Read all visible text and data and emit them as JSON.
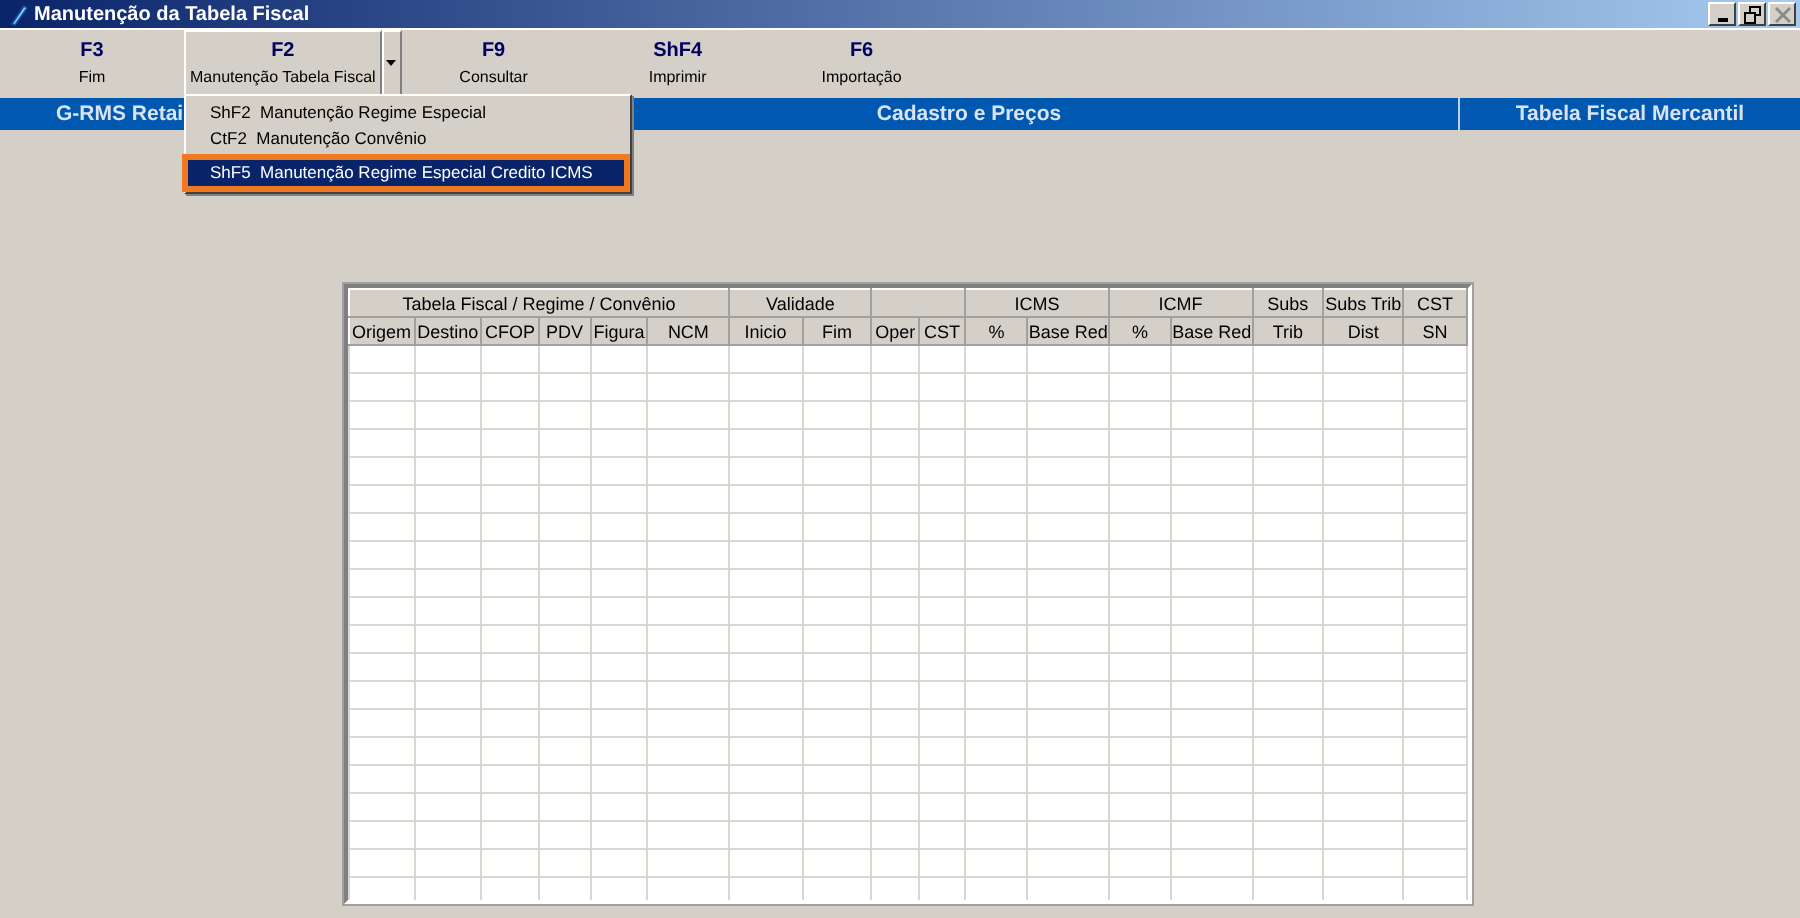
{
  "window": {
    "title": "Manutenção da Tabela Fiscal"
  },
  "toolbar": [
    {
      "key": "F3",
      "label": "Fim",
      "kind": "plain",
      "pressed": false
    },
    {
      "key": "F2",
      "label": "Manutenção Tabela Fiscal",
      "kind": "split",
      "pressed": true
    },
    {
      "key": "F9",
      "label": "Consultar",
      "kind": "plain",
      "pressed": false
    },
    {
      "key": "ShF4",
      "label": "Imprimir",
      "kind": "plain",
      "pressed": false
    },
    {
      "key": "F6",
      "label": "Importação",
      "kind": "plain",
      "pressed": false
    }
  ],
  "menu": {
    "items": [
      {
        "key": "ShF2",
        "label": "Manutenção Regime Especial",
        "selected": false
      },
      {
        "key": "CtF2",
        "label": "Manutenção Convênio",
        "selected": false
      },
      {
        "key": "ShF5",
        "label": "Manutenção Regime Especial Credito ICMS",
        "selected": true
      }
    ]
  },
  "band": {
    "left": "G-RMS Retai",
    "center": "Cadastro e Preços",
    "right": "Tabela Fiscal Mercantil"
  },
  "table": {
    "groups": [
      {
        "label": "Tabela Fiscal / Regime / Convênio",
        "columns": [
          "Origem",
          "Destino",
          "CFOP",
          "PDV",
          "Figura",
          "NCM"
        ]
      },
      {
        "label": "Validade",
        "columns": [
          "Inicio",
          "Fim"
        ]
      },
      {
        "columns": [
          "Oper",
          "CST"
        ]
      },
      {
        "label": "ICMS",
        "columns": [
          "%",
          "Base Red"
        ]
      },
      {
        "label": "ICMF",
        "columns": [
          "%",
          "Base Red"
        ]
      },
      {
        "label": "Subs",
        "columns": [
          "Trib"
        ]
      },
      {
        "label": "Subs Trib",
        "columns": [
          "Dist"
        ]
      },
      {
        "label": "CST",
        "columns": [
          "SN"
        ]
      }
    ]
  }
}
